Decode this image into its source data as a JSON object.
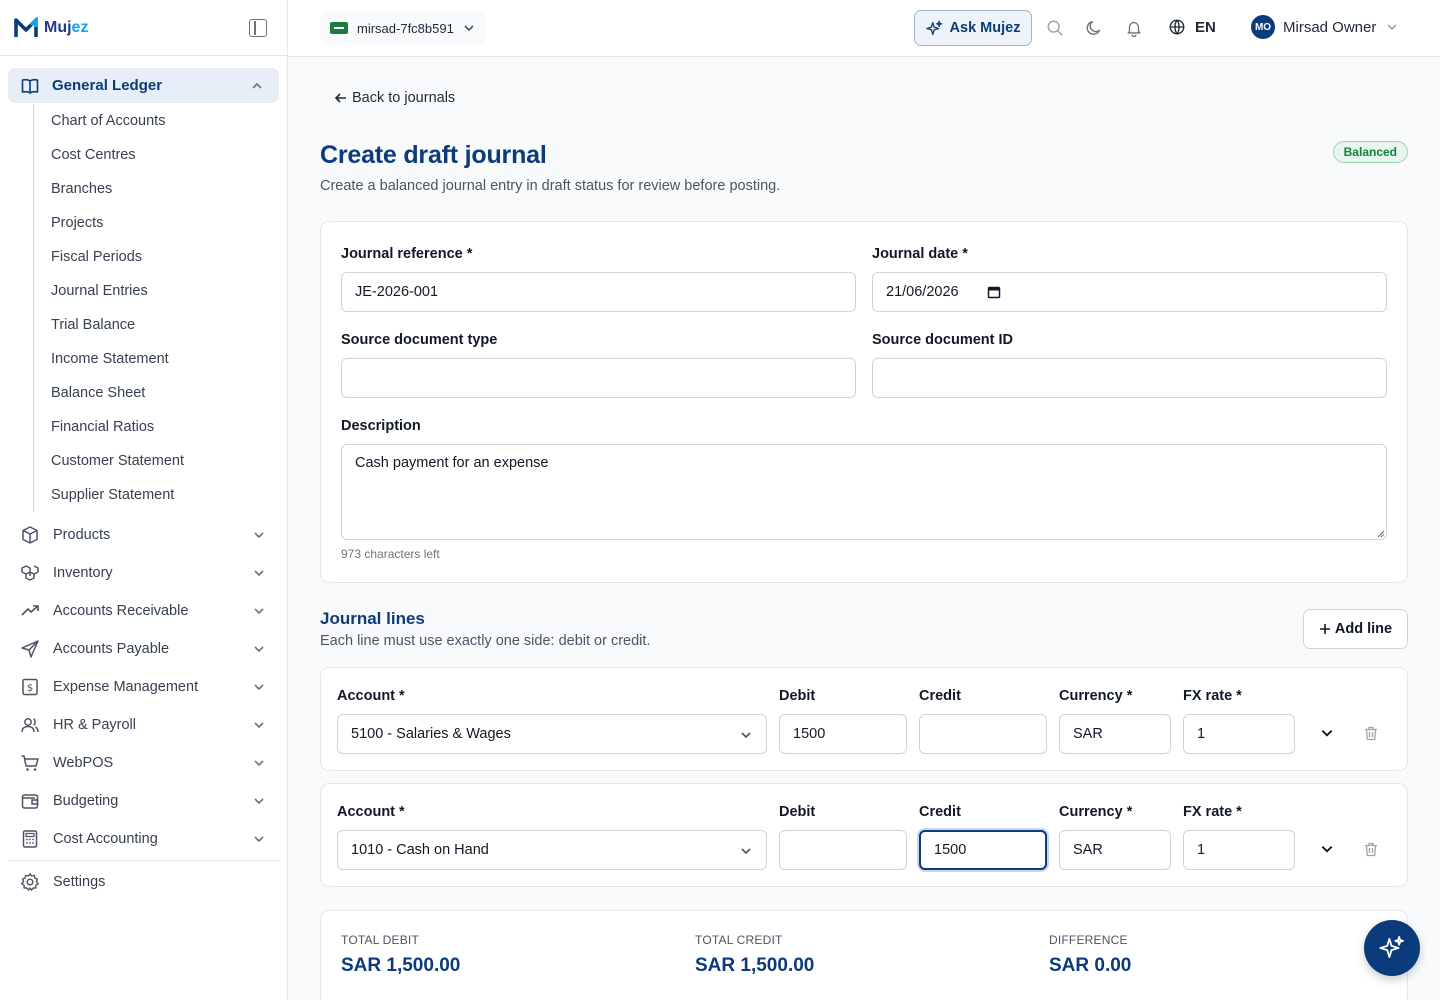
{
  "app": {
    "name_main": "Muj",
    "name_accent": "ez"
  },
  "topbar": {
    "org": "mirsad-7fc8b591",
    "ask_label": "Ask Mujez",
    "language": "EN",
    "user_initials": "MO",
    "user_name": "Mirsad Owner"
  },
  "sidebar": {
    "active_group": "General Ledger",
    "sub_items": [
      "Chart of Accounts",
      "Cost Centres",
      "Branches",
      "Projects",
      "Fiscal Periods",
      "Journal Entries",
      "Trial Balance",
      "Income Statement",
      "Balance Sheet",
      "Financial Ratios",
      "Customer Statement",
      "Supplier Statement"
    ],
    "groups": [
      {
        "label": "Products",
        "icon": "box-icon"
      },
      {
        "label": "Inventory",
        "icon": "boxes-icon"
      },
      {
        "label": "Accounts Receivable",
        "icon": "trend-up-icon"
      },
      {
        "label": "Accounts Payable",
        "icon": "send-icon"
      },
      {
        "label": "Expense Management",
        "icon": "receipt-icon"
      },
      {
        "label": "HR & Payroll",
        "icon": "users-icon"
      },
      {
        "label": "WebPOS",
        "icon": "cart-icon"
      },
      {
        "label": "Budgeting",
        "icon": "wallet-icon"
      },
      {
        "label": "Cost Accounting",
        "icon": "calculator-icon"
      }
    ],
    "settings": "Settings"
  },
  "page": {
    "back_label": "Back to journals",
    "title": "Create draft journal",
    "subtitle": "Create a balanced journal entry in draft status for review before posting.",
    "status_badge": "Balanced"
  },
  "form": {
    "ref_label": "Journal reference *",
    "ref_value": "JE-2026-001",
    "date_label": "Journal date *",
    "date_value": "21/06/2026",
    "src_type_label": "Source document type",
    "src_type_value": "",
    "src_id_label": "Source document ID",
    "src_id_value": "",
    "desc_label": "Description",
    "desc_value": "Cash payment for an expense",
    "chars_left": "973 characters left"
  },
  "lines_section": {
    "title": "Journal lines",
    "subtitle": "Each line must use exactly one side: debit or credit.",
    "add_label": "Add line",
    "col_account": "Account *",
    "col_debit": "Debit",
    "col_credit": "Credit",
    "col_currency": "Currency *",
    "col_fx": "FX rate *"
  },
  "lines": [
    {
      "account": "5100 - Salaries & Wages",
      "debit": "1500",
      "credit": "",
      "currency": "SAR",
      "fx": "1"
    },
    {
      "account": "1010 - Cash on Hand",
      "debit": "",
      "credit": "1500",
      "currency": "SAR",
      "fx": "1"
    }
  ],
  "totals": {
    "debit_label": "TOTAL DEBIT",
    "debit_value": "SAR 1,500.00",
    "credit_label": "TOTAL CREDIT",
    "credit_value": "SAR 1,500.00",
    "diff_label": "DIFFERENCE",
    "diff_value": "SAR 0.00"
  },
  "colors": {
    "brand": "#0b3b7a",
    "accent": "#0ea5e9",
    "success": "#15803d"
  }
}
